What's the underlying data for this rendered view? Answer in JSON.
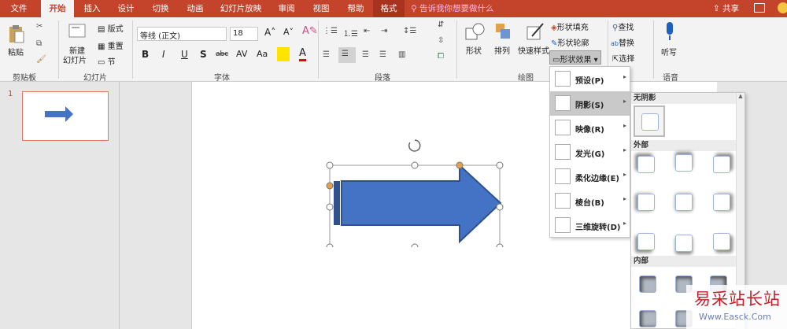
{
  "tabs": [
    "文件",
    "开始",
    "插入",
    "设计",
    "切换",
    "动画",
    "幻灯片放映",
    "审阅",
    "视图",
    "帮助",
    "格式"
  ],
  "active_tab": "开始",
  "tell_me": "告诉我你想要做什么",
  "share": "共享",
  "ribbon": {
    "clipboard": {
      "label": "剪贴板",
      "paste": "粘贴"
    },
    "slides": {
      "label": "幻灯片",
      "new_slide_1": "新建",
      "new_slide_2": "幻灯片",
      "layout": "版式",
      "reset": "重置",
      "section": "节"
    },
    "font": {
      "label": "字体",
      "family": "等线 (正文)",
      "size": "18",
      "bold": "B",
      "italic": "I",
      "underline": "U",
      "strike": "S",
      "abc": "abc",
      "av": "AV",
      "aa": "Aa",
      "a": "A"
    },
    "paragraph": {
      "label": "段落"
    },
    "drawing": {
      "label": "绘图",
      "shapes": "形状",
      "arrange": "排列",
      "quick_styles": "快速样式",
      "fill": "形状填充",
      "outline": "形状轮廓",
      "effects": "形状效果"
    },
    "editing": {
      "find": "查找",
      "replace": "替换",
      "select": "选择"
    },
    "voice": {
      "label": "语音",
      "dictate": "听写"
    }
  },
  "slide_number": "1",
  "effects_menu": [
    "预设(P)",
    "阴影(S)",
    "映像(R)",
    "发光(G)",
    "柔化边缘(E)",
    "棱台(B)",
    "三维旋转(D)"
  ],
  "shadow_menu": {
    "no_shadow": "无阴影",
    "outer": "外部",
    "inner": "内部"
  },
  "watermark": {
    "cn": "易采站长站",
    "url": "Www.Easck.Com"
  },
  "colors": {
    "accent": "#c4432b",
    "arrow": "#4472c4",
    "arrow_dark": "#2f528f"
  }
}
